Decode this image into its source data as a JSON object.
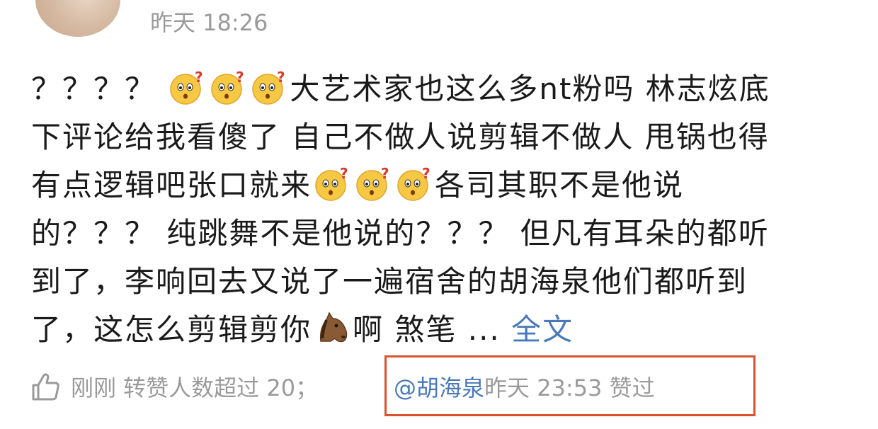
{
  "post": {
    "timestamp": "昨天 18:26",
    "lines": [
      [
        {
          "t": "？？？？ "
        },
        {
          "e": "confused-face-emoji"
        },
        {
          "e": "confused-face-emoji"
        },
        {
          "e": "confused-face-emoji"
        },
        {
          "t": "大艺术家也这么多nt粉吗 林志炫底"
        }
      ],
      [
        {
          "t": "下评论给我看傻了 自己不做人说剪辑不做人 甩锅也得"
        }
      ],
      [
        {
          "t": "有点逻辑吧张口就来"
        },
        {
          "e": "confused-face-emoji"
        },
        {
          "e": "confused-face-emoji"
        },
        {
          "e": "confused-face-emoji"
        },
        {
          "t": "各司其职不是他说"
        }
      ],
      [
        {
          "t": "的？？？ 纯跳舞不是他说的？？？ 但凡有耳朵的都听"
        }
      ],
      [
        {
          "t": "到了，李响回去又说了一遍宿舍的胡海泉他们都听到"
        }
      ],
      [
        {
          "t": "了，这怎么剪辑剪你"
        },
        {
          "e": "horse-face-emoji"
        },
        {
          "t": "啊 煞笔 ... "
        }
      ]
    ],
    "fulltext_link": "全文"
  },
  "footer": {
    "like_icon": "thumbs-up-icon",
    "left_text": "刚刚 转赞人数超过 20；",
    "mention": "@胡海泉",
    "right_text": " 昨天 23:53 赞过"
  },
  "colors": {
    "link": "#4a79b8",
    "muted": "#9a9a9a",
    "text": "#1a1a1a",
    "highlight_border": "#d8532e"
  }
}
